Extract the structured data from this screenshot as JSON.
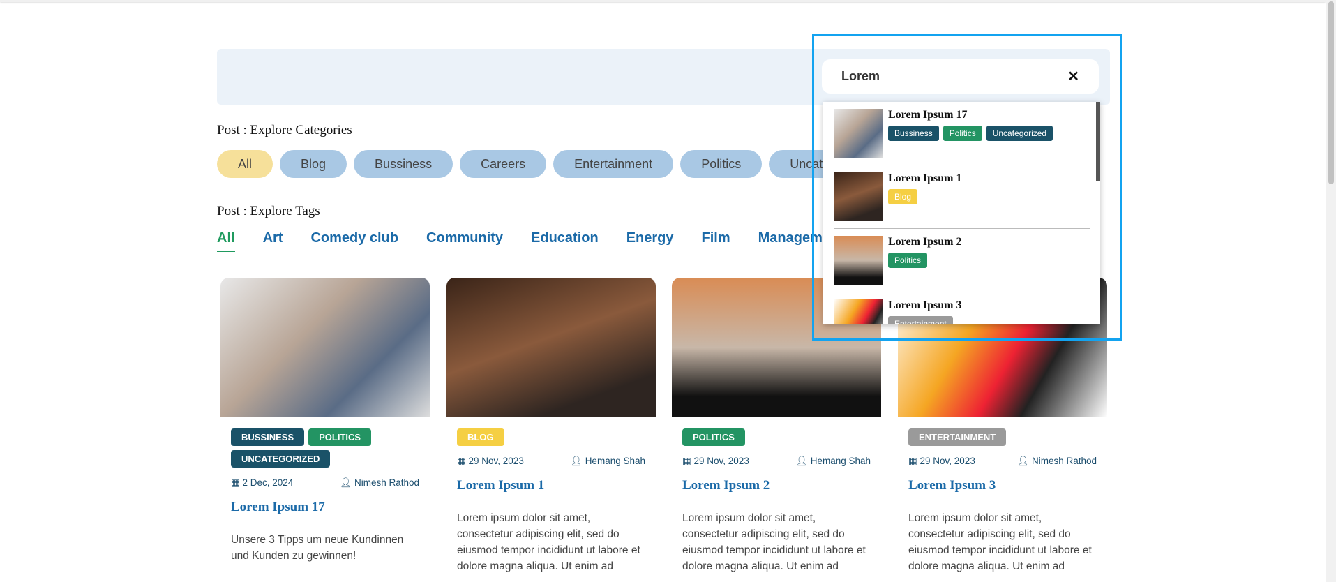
{
  "categories": {
    "title": "Post : Explore Categories",
    "items": [
      "All",
      "Blog",
      "Bussiness",
      "Careers",
      "Entertainment",
      "Politics",
      "Uncategorized"
    ]
  },
  "tags": {
    "title": "Post : Explore Tags",
    "items": [
      "All",
      "Art",
      "Comedy club",
      "Community",
      "Education",
      "Energy",
      "Film",
      "Management"
    ]
  },
  "colors": {
    "bussiness": "#1a5268",
    "politics": "#239463",
    "uncategorized": "#1a5268",
    "blog": "#f5cf43",
    "entertainment": "#9a9a9a"
  },
  "search": {
    "value": "Lorem",
    "clear_icon": "close-icon",
    "results": [
      {
        "title": "Lorem Ipsum 17",
        "badges": [
          "Bussiness",
          "Politics",
          "Uncategorized"
        ]
      },
      {
        "title": "Lorem Ipsum 1",
        "badges": [
          "Blog"
        ]
      },
      {
        "title": "Lorem Ipsum 2",
        "badges": [
          "Politics"
        ]
      },
      {
        "title": "Lorem Ipsum 3",
        "badges": [
          "Entertainment"
        ]
      }
    ]
  },
  "posts": [
    {
      "title": "Lorem Ipsum 17",
      "badges": [
        "Bussiness",
        "Politics",
        "Uncategorized"
      ],
      "date": "2 Dec, 2024",
      "author": "Nimesh Rathod",
      "excerpt": "Unsere 3 Tipps um neue Kundinnen und Kunden zu gewinnen!"
    },
    {
      "title": "Lorem Ipsum 1",
      "badges": [
        "Blog"
      ],
      "date": "29 Nov, 2023",
      "author": "Hemang Shah",
      "excerpt": "Lorem ipsum dolor sit amet, consectetur adipiscing elit, sed do eiusmod tempor incididunt ut labore et dolore magna aliqua. Ut enim ad"
    },
    {
      "title": "Lorem Ipsum 2",
      "badges": [
        "Politics"
      ],
      "date": "29 Nov, 2023",
      "author": "Hemang Shah",
      "excerpt": "Lorem ipsum dolor sit amet, consectetur adipiscing elit, sed do eiusmod tempor incididunt ut labore et dolore magna aliqua. Ut enim ad"
    },
    {
      "title": "Lorem Ipsum 3",
      "badges": [
        "Entertainment"
      ],
      "date": "29 Nov, 2023",
      "author": "Nimesh Rathod",
      "excerpt": "Lorem ipsum dolor sit amet, consectetur adipiscing elit, sed do eiusmod tempor incididunt ut labore et dolore magna aliqua. Ut enim ad"
    }
  ]
}
